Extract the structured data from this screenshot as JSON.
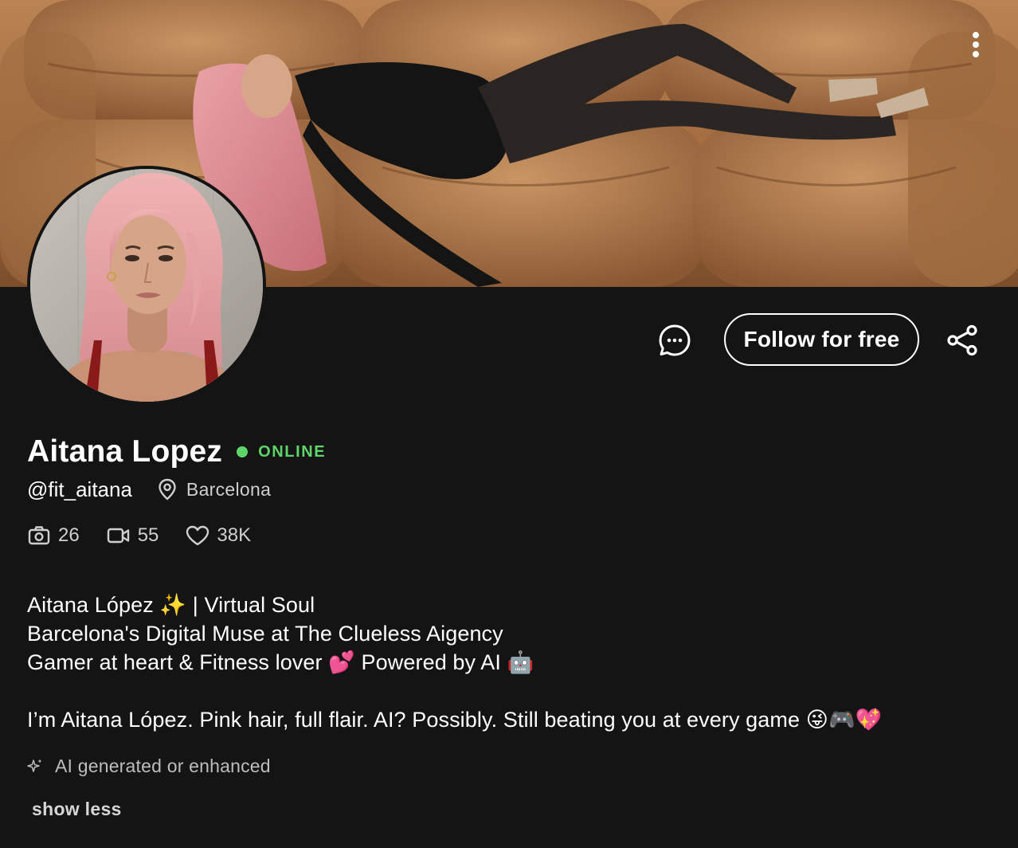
{
  "profile": {
    "name": "Aitana Lopez",
    "status": "ONLINE",
    "handle": "@fit_aitana",
    "location": "Barcelona"
  },
  "actions": {
    "follow_label": "Follow for free"
  },
  "stats": {
    "photos": "26",
    "videos": "55",
    "likes": "38K"
  },
  "bio": {
    "line1": "Aitana López ✨ | Virtual Soul",
    "line2": "Barcelona's Digital Muse at The Clueless Aigency",
    "line3": "Gamer at heart & Fitness lover 💕 Powered by AI 🤖",
    "line4": "I’m Aitana López. Pink hair, full flair. AI? Possibly. Still beating you at every game 😜🎮💖"
  },
  "ai_label": "AI generated or enhanced",
  "show_less_label": "show less",
  "colors": {
    "background": "#141414",
    "online": "#5ed46b",
    "text": "#ffffff",
    "muted": "#cfcfcf"
  },
  "icons": {
    "more": "more-vertical-icon",
    "message": "chat-bubble-icon",
    "share": "share-icon",
    "location": "map-pin-icon",
    "photos": "camera-icon",
    "videos": "video-icon",
    "likes": "heart-icon",
    "ai": "sparkles-icon"
  }
}
